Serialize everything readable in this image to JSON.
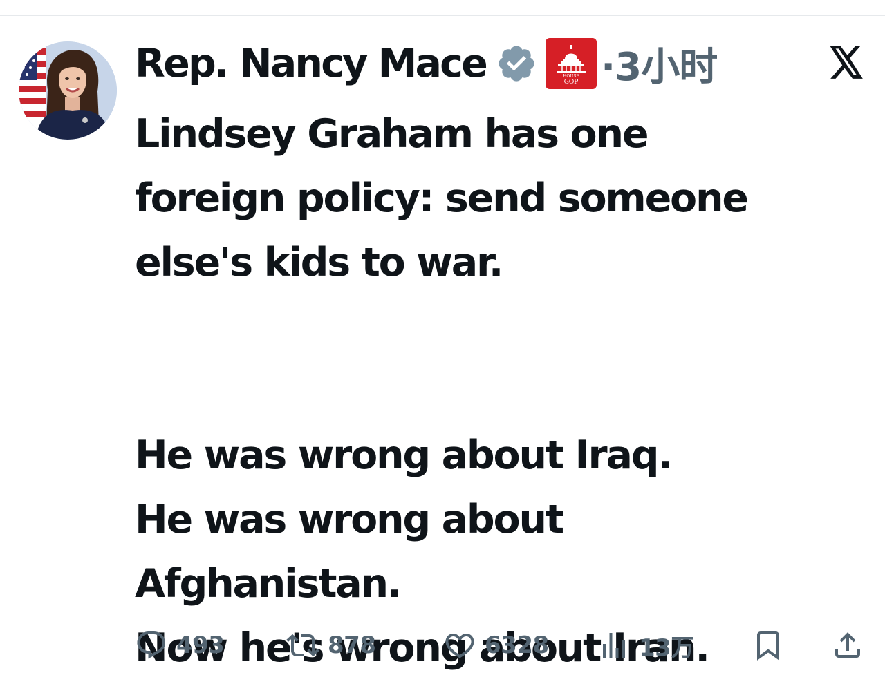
{
  "author": {
    "display_name": "Rep. Nancy Mace",
    "verified_icon": "verified-badge-icon",
    "affiliation_badge": {
      "icon": "house-gop-badge-icon",
      "line1": "HOUSE",
      "line2": "GOP",
      "color": "#d61f26"
    },
    "time_ago": "·3小时"
  },
  "platform_icon": "x-logo-icon",
  "tweet": {
    "text": "Lindsey Graham has one\nforeign policy: send someone\nelse's kids to war.\n\n\nHe was wrong about Iraq.\nHe was wrong about\nAfghanistan.\nNow he's wrong about Iran."
  },
  "actions": {
    "replies": {
      "icon": "reply-icon",
      "count": "493"
    },
    "reposts": {
      "icon": "repost-icon",
      "count": "878"
    },
    "likes": {
      "icon": "like-icon",
      "count": "6328"
    },
    "views": {
      "icon": "views-icon",
      "count": "13万"
    },
    "bookmark": {
      "icon": "bookmark-icon"
    },
    "share": {
      "icon": "share-icon"
    }
  },
  "colors": {
    "text": "#0f1419",
    "secondary": "#536471",
    "verified_gray": "#829aab"
  }
}
